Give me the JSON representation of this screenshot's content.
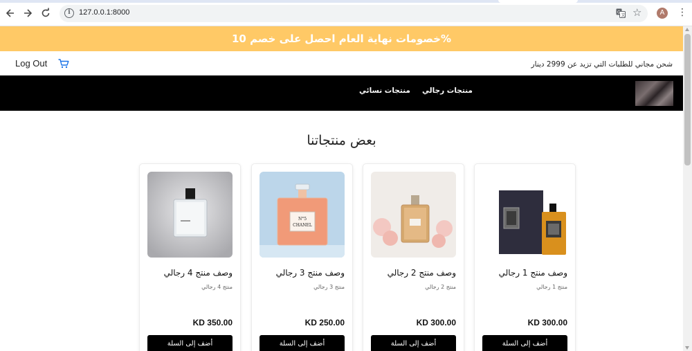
{
  "browser": {
    "url": "127.0.0.1:8000",
    "profile_initial": "A",
    "icons": [
      "back-arrow-icon",
      "forward-arrow-icon",
      "reload-icon",
      "site-info-icon",
      "translate-icon",
      "bookmark-star-icon",
      "profile-avatar-icon",
      "menu-kebab-icon"
    ]
  },
  "promo_banner": {
    "text": "خصومات نهاية العام احصل على خصم 10%",
    "background": "#ffc966"
  },
  "info_bar": {
    "logout_label": "Log Out",
    "cart_icon": "shopping-cart-icon",
    "cart_color": "#1a73e8",
    "shipping_text": "شحن مجاني للطلبات التي تزيد عن 2999 دينار"
  },
  "navbar": {
    "links": [
      "منتجات رجالي",
      "منتجات نسائي"
    ]
  },
  "section": {
    "title": "بعض منتجاتنا"
  },
  "products": [
    {
      "title": "وصف منتج 1 رجالي",
      "desc": "منتج 1 رجالي",
      "price": "KD 300.00",
      "button": "أضف إلى السلة"
    },
    {
      "title": "وصف منتج 2 رجالي",
      "desc": "منتج 2 رجالي",
      "price": "KD 300.00",
      "button": "أضف إلى السلة"
    },
    {
      "title": "وصف منتج 3 رجالي",
      "desc": "منتج 3 رجالي",
      "price": "KD 250.00",
      "button": "أضف إلى السلة"
    },
    {
      "title": "وصف منتج 4 رجالي",
      "desc": "منتج 4 رجالي",
      "price": "KD 350.00",
      "button": "أضف إلى السلة"
    }
  ],
  "product_images": {
    "p3_label_line1": "N°5",
    "p3_label_line2": "CHANEL"
  }
}
